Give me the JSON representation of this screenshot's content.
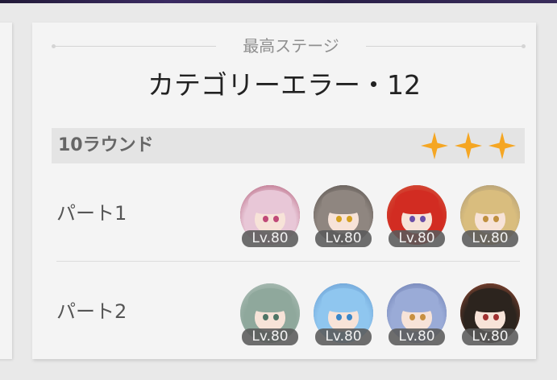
{
  "best_stage": {
    "label": "最高ステージ",
    "name": "カテゴリーエラー・12"
  },
  "rounds": {
    "label": "10ラウンド",
    "stars": 3
  },
  "colors": {
    "star": "#f5a623",
    "level_badge": "#5a5a5a"
  },
  "parts": [
    {
      "label": "パート1",
      "characters": [
        {
          "level": "Lv.80",
          "hair": "#e8c7d7",
          "bg": "#a4405e",
          "eye": "#c04a78"
        },
        {
          "level": "Lv.80",
          "hair": "#8f8680",
          "bg": "#4a4440",
          "eye": "#d4a020"
        },
        {
          "level": "Lv.80",
          "hair": "#d22c22",
          "bg": "#d36044",
          "eye": "#6b4fa8"
        },
        {
          "level": "Lv.80",
          "hair": "#d9bd7e",
          "bg": "#9c8c72",
          "eye": "#c09040"
        }
      ]
    },
    {
      "label": "パート2",
      "characters": [
        {
          "level": "Lv.80",
          "hair": "#8fa89c",
          "bg": "#b9c7c1",
          "eye": "#4f7566"
        },
        {
          "level": "Lv.80",
          "hair": "#8fc6ef",
          "bg": "#5c8fc8",
          "eye": "#3a86c8"
        },
        {
          "level": "Lv.80",
          "hair": "#9aabd7",
          "bg": "#6070a6",
          "eye": "#c89040"
        },
        {
          "level": "Lv.80",
          "hair": "#2c241e",
          "bg": "#b8583c",
          "eye": "#a03030"
        }
      ]
    }
  ]
}
